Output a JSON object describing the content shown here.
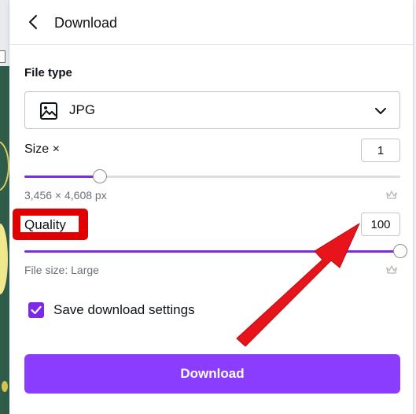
{
  "header": {
    "title": "Download"
  },
  "file_type": {
    "label": "File type",
    "selected": "JPG"
  },
  "size": {
    "label": "Size ×",
    "value": "1",
    "slider_fraction": 0.2,
    "dimensions": "3,456 × 4,608 px"
  },
  "quality": {
    "label": "Quality",
    "value": "100",
    "slider_fraction": 1.0,
    "file_size": "File size: Large"
  },
  "save_settings": {
    "label": "Save download settings",
    "checked": true
  },
  "download_button": {
    "label": "Download"
  },
  "colors": {
    "accent": "#7d2ae8",
    "button": "#8b3dff",
    "highlight": "#e00000"
  },
  "icons": {
    "back": "chevron-left-icon",
    "file_type": "image-icon",
    "dropdown": "chevron-down-icon",
    "premium": "crown-icon",
    "check": "check-icon"
  }
}
